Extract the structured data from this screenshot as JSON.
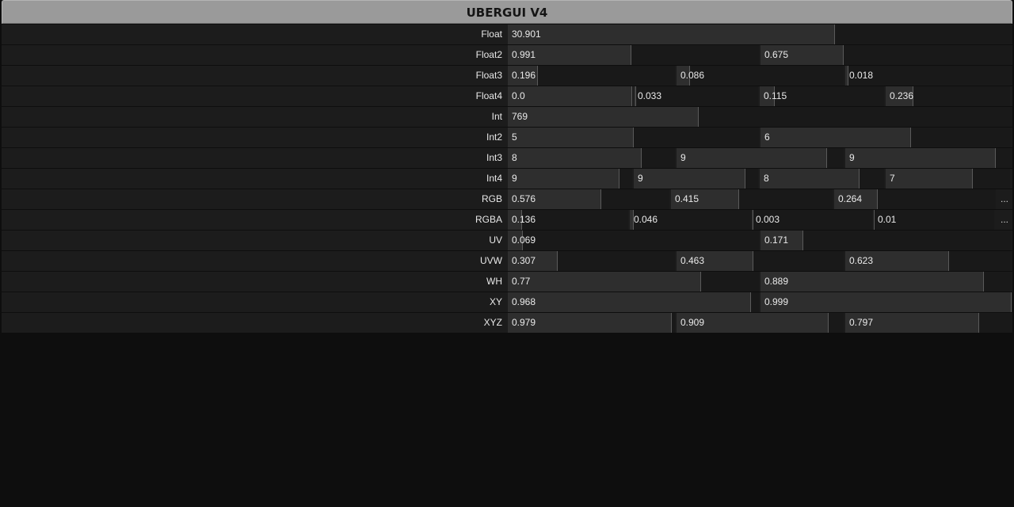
{
  "header": {
    "title": "UBERGUI V4"
  },
  "color_picker_label": "...",
  "rows": [
    {
      "label": "Float",
      "fields": [
        {
          "value": "30.901",
          "fill": 0.648
        }
      ]
    },
    {
      "label": "Float2",
      "fields": [
        {
          "value": "0.991",
          "fill": 0.491
        },
        {
          "value": "0.675",
          "fill": 0.33
        }
      ]
    },
    {
      "label": "Float3",
      "fields": [
        {
          "value": "0.196",
          "fill": 0.18
        },
        {
          "value": "0.086",
          "fill": 0.08
        },
        {
          "value": "0.018",
          "fill": 0.02
        }
      ]
    },
    {
      "label": "Float4",
      "fields": [
        {
          "value": "0.0",
          "fill": 1.0
        },
        {
          "value": "0.033",
          "fill": 0.02
        },
        {
          "value": "0.115",
          "fill": 0.12
        },
        {
          "value": "0.236",
          "fill": 0.22
        }
      ]
    },
    {
      "label": "Int",
      "fields": [
        {
          "value": "769",
          "fill": 0.378
        }
      ]
    },
    {
      "label": "Int2",
      "fields": [
        {
          "value": "5",
          "fill": 0.5
        },
        {
          "value": "6",
          "fill": 0.6
        }
      ]
    },
    {
      "label": "Int3",
      "fields": [
        {
          "value": "8",
          "fill": 0.8
        },
        {
          "value": "9",
          "fill": 0.9
        },
        {
          "value": "9",
          "fill": 0.9
        }
      ]
    },
    {
      "label": "Int4",
      "fields": [
        {
          "value": "9",
          "fill": 0.9
        },
        {
          "value": "9",
          "fill": 0.9
        },
        {
          "value": "8",
          "fill": 0.8
        },
        {
          "value": "7",
          "fill": 0.7
        }
      ]
    },
    {
      "label": "RGB",
      "color": true,
      "fields": [
        {
          "value": "0.576",
          "fill": 0.58
        },
        {
          "value": "0.415",
          "fill": 0.42
        },
        {
          "value": "0.264",
          "fill": 0.27
        }
      ]
    },
    {
      "label": "RGBA",
      "color": true,
      "fields": [
        {
          "value": "0.136",
          "fill": 0.12
        },
        {
          "value": "0.046",
          "fill": 0.03
        },
        {
          "value": "0.003",
          "fill": 0.01
        },
        {
          "value": "0.01",
          "fill": 0.0
        }
      ]
    },
    {
      "label": "UV",
      "fields": [
        {
          "value": "0.069",
          "fill": 0.06
        },
        {
          "value": "0.171",
          "fill": 0.17
        }
      ]
    },
    {
      "label": "UVW",
      "fields": [
        {
          "value": "0.307",
          "fill": 0.3
        },
        {
          "value": "0.463",
          "fill": 0.46
        },
        {
          "value": "0.623",
          "fill": 0.62
        }
      ]
    },
    {
      "label": "WH",
      "fields": [
        {
          "value": "0.77",
          "fill": 0.77
        },
        {
          "value": "0.889",
          "fill": 0.89
        }
      ]
    },
    {
      "label": "XY",
      "fields": [
        {
          "value": "0.968",
          "fill": 0.97
        },
        {
          "value": "0.999",
          "fill": 1.0
        }
      ]
    },
    {
      "label": "XYZ",
      "fields": [
        {
          "value": "0.979",
          "fill": 0.98
        },
        {
          "value": "0.909",
          "fill": 0.91
        },
        {
          "value": "0.797",
          "fill": 0.8
        }
      ]
    }
  ]
}
